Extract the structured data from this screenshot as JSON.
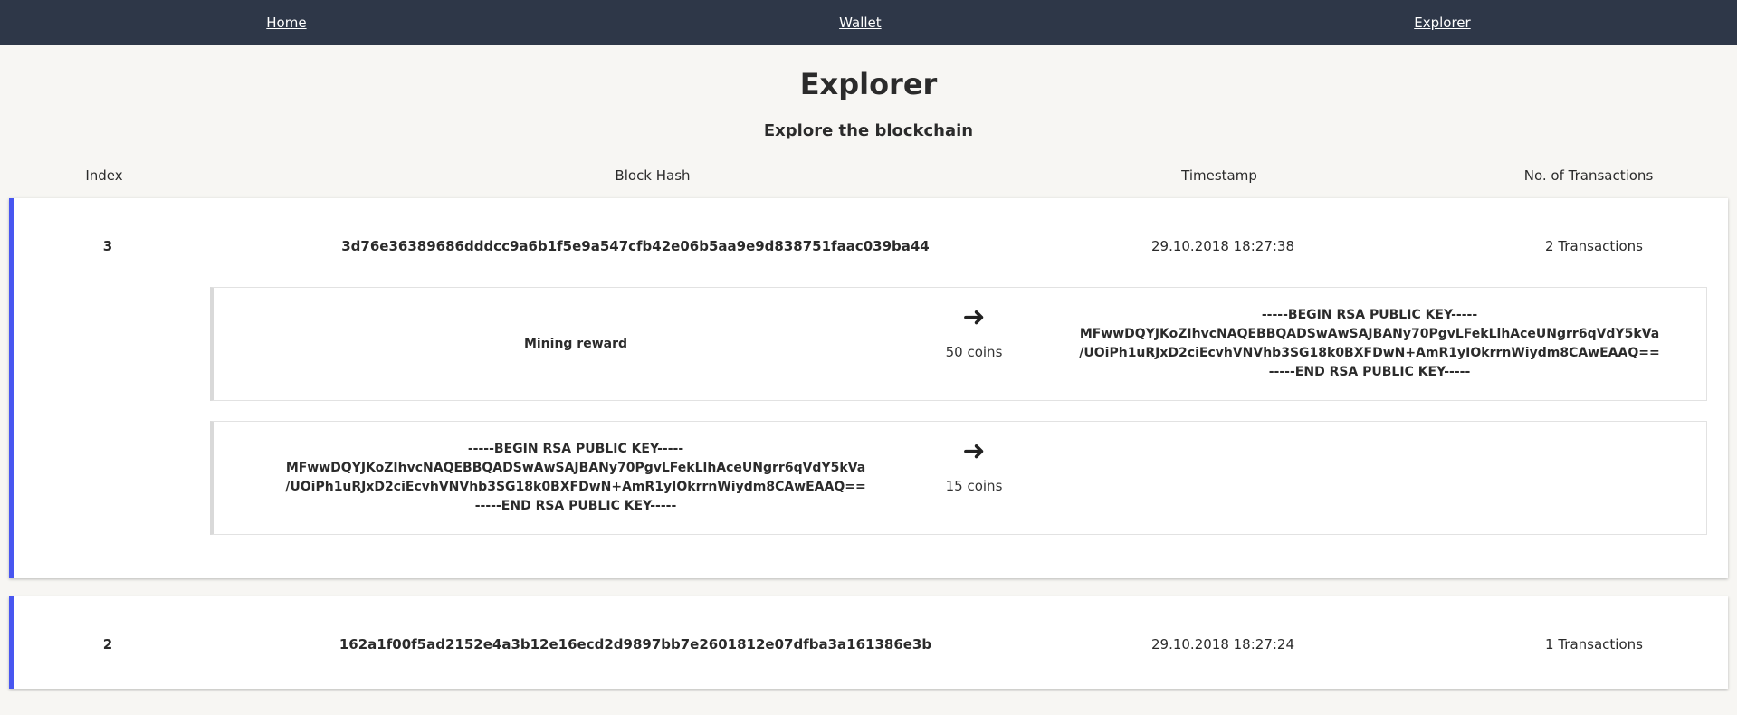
{
  "nav": {
    "home": "Home",
    "wallet": "Wallet",
    "explorer": "Explorer"
  },
  "page": {
    "title": "Explorer",
    "subtitle": "Explore the blockchain"
  },
  "table": {
    "headers": [
      "Index",
      "Block Hash",
      "Timestamp",
      "No. of Transactions"
    ]
  },
  "blocks": [
    {
      "index": "3",
      "hash": "3d76e36389686dddcc9a6b1f5e9a547cfb42e06b5aa9e9d838751faac039ba44",
      "timestamp": "29.10.2018 18:27:38",
      "tx_count": "2 Transactions",
      "transactions": [
        {
          "from": "Mining reward",
          "amount": "50 coins",
          "to_lines": [
            "-----BEGIN RSA PUBLIC KEY-----",
            "MFwwDQYJKoZIhvcNAQEBBQADSwAwSAJBANy70PgvLFekLlhAceUNgrr6qVdY5kVa",
            "/UOiPh1uRJxD2ciEcvhVNVhb3SG18k0BXFDwN+AmR1yIOkrrnWiydm8CAwEAAQ==",
            "-----END RSA PUBLIC KEY-----"
          ]
        },
        {
          "from_lines": [
            "-----BEGIN RSA PUBLIC KEY-----",
            "MFwwDQYJKoZIhvcNAQEBBQADSwAwSAJBANy70PgvLFekLlhAceUNgrr6qVdY5kVa",
            "/UOiPh1uRJxD2ciEcvhVNVhb3SG18k0BXFDwN+AmR1yIOkrrnWiydm8CAwEAAQ==",
            "-----END RSA PUBLIC KEY-----"
          ],
          "amount": "15 coins"
        }
      ]
    },
    {
      "index": "2",
      "hash": "162a1f00f5ad2152e4a3b12e16ecd2d9897bb7e2601812e07dfba3a161386e3b",
      "timestamp": "29.10.2018 18:27:24",
      "tx_count": "1 Transactions"
    }
  ],
  "icons": {
    "arrow": "right-arrow-icon"
  },
  "colors": {
    "nav_bg": "#2e3748",
    "accent": "#4856f0",
    "page_bg": "#f7f6f3"
  }
}
